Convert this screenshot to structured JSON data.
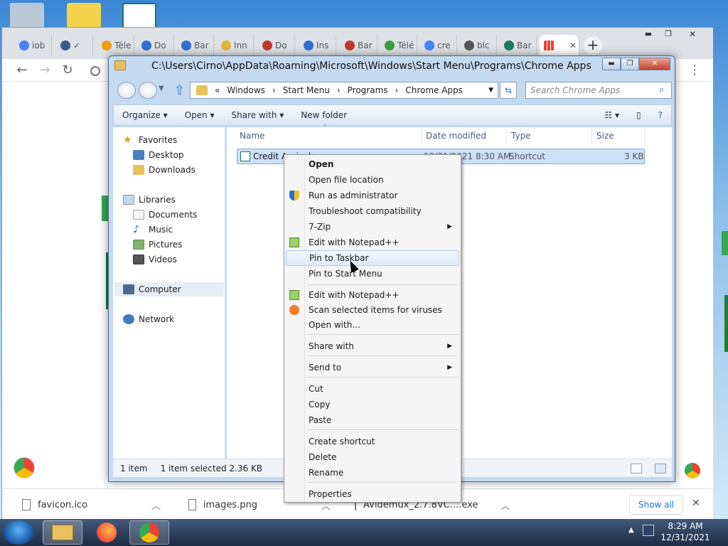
{
  "chrome": {
    "tabs": [
      {
        "label": "iob",
        "color": "#4285f4"
      },
      {
        "label": "✓",
        "color": "#3b5b8f"
      },
      {
        "label": "Téle",
        "color": "#f39c12"
      },
      {
        "label": "Do",
        "color": "#2f6fd1"
      },
      {
        "label": "Bar",
        "color": "#2f6fd1"
      },
      {
        "label": "Inn",
        "color": "#e2b33b"
      },
      {
        "label": "Do",
        "color": "#c0392b"
      },
      {
        "label": "Ins",
        "color": "#2f6fd1"
      },
      {
        "label": "Bar",
        "color": "#c0392b"
      },
      {
        "label": "Télé",
        "color": "#3c9d3c"
      },
      {
        "label": "cre",
        "color": "#4285f4"
      },
      {
        "label": "blc",
        "color": "#555555"
      },
      {
        "label": "Bar",
        "color": "#1a7a5a"
      }
    ],
    "close_tab_glyph": "✕",
    "new_tab_glyph": "+",
    "menu_glyph": "⋮",
    "downloads": [
      {
        "name": "favicon.ico"
      },
      {
        "name": "images.png"
      },
      {
        "name": "Avidemux_2.7.8VC....exe"
      }
    ],
    "show_all_label": "Show all",
    "close_bar_glyph": "✕"
  },
  "explorer": {
    "title": "C:\\Users\\Cirno\\AppData\\Roaming\\Microsoft\\Windows\\Start Menu\\Programs\\Chrome Apps",
    "breadcrumb": [
      "«",
      "Windows",
      "Start Menu",
      "Programs",
      "Chrome Apps"
    ],
    "search_placeholder": "Search Chrome Apps",
    "commands": {
      "organize": "Organize",
      "open": "Open",
      "share_with": "Share with",
      "new_folder": "New folder"
    },
    "nav": {
      "favorites": "Favorites",
      "favorites_items": [
        "Desktop",
        "Downloads"
      ],
      "libraries": "Libraries",
      "libraries_items": [
        "Documents",
        "Music",
        "Pictures",
        "Videos"
      ],
      "computer": "Computer",
      "network": "Network"
    },
    "columns": {
      "name": "Name",
      "date": "Date modified",
      "type": "Type",
      "size": "Size"
    },
    "file": {
      "name": "Credit Agricole",
      "date": "12/31/2021 8:30 AM",
      "type": "Shortcut",
      "size": "3 KB"
    },
    "status": {
      "items": "1 item",
      "selected": "1 item selected  2.36 KB"
    }
  },
  "context_menu": {
    "items": [
      {
        "label": "Open",
        "bold": true
      },
      {
        "label": "Open file location"
      },
      {
        "label": "Run as administrator",
        "icon": "shield-icon"
      },
      {
        "label": "Troubleshoot compatibility"
      },
      {
        "label": "7-Zip",
        "submenu": true
      },
      {
        "label": "Edit with Notepad++",
        "icon": "notepad-icon"
      },
      {
        "label": "Pin to Taskbar",
        "hover": true
      },
      {
        "label": "Pin to Start Menu"
      },
      {
        "label": "Edit with Notepad++",
        "icon": "notepad-icon"
      },
      {
        "label": "Scan selected items for viruses",
        "icon": "avast-icon"
      },
      {
        "label": "Open with..."
      },
      {
        "label": "Share with",
        "submenu": true
      },
      {
        "label": "Send to",
        "submenu": true
      },
      {
        "label": "Cut"
      },
      {
        "label": "Copy"
      },
      {
        "label": "Paste"
      },
      {
        "label": "Create shortcut"
      },
      {
        "label": "Delete"
      },
      {
        "label": "Rename"
      },
      {
        "label": "Properties"
      }
    ]
  },
  "taskbar": {
    "time": "8:29 AM",
    "date": "12/31/2021"
  }
}
